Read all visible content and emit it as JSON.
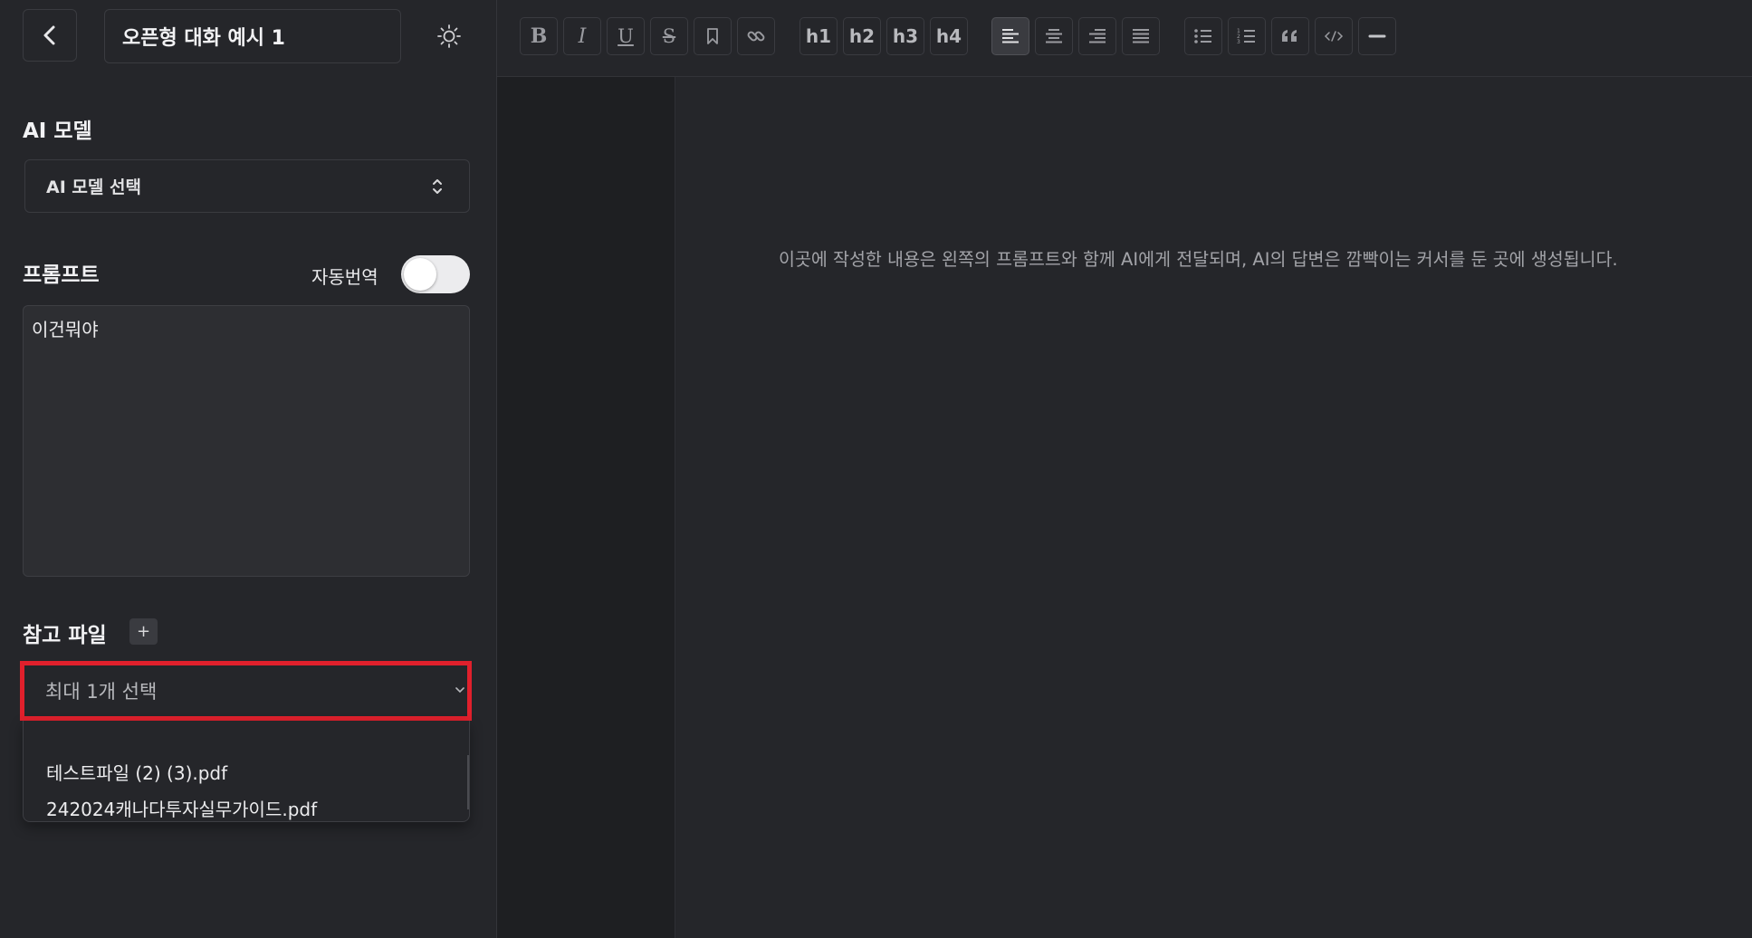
{
  "header": {
    "title": "오픈형 대화 예시 1"
  },
  "model": {
    "section_label": "AI 모델",
    "select_value": "AI 모델 선택"
  },
  "prompt": {
    "section_label": "프롬프트",
    "auto_translate_label": "자동번역",
    "auto_translate_on": false,
    "value": "이건뭐야"
  },
  "files": {
    "section_label": "참고 파일",
    "add_label": "+",
    "select_placeholder": "최대 1개 선택",
    "options": [
      "테스트파일 (2) (3).pdf",
      "242024캐나다투자실무가이드.pdf"
    ]
  },
  "toolbar": {
    "h1": "h1",
    "h2": "h2",
    "h3": "h3",
    "h4": "h4"
  },
  "editor": {
    "placeholder": "이곳에 작성한 내용은 왼쪽의 프롬프트와 함께 AI에게 전달되며, AI의 답변은 깜빡이는 커서를 둔 곳에 생성됩니다."
  },
  "colors": {
    "background": "#25262a",
    "highlight": "#e0202c",
    "gutter": "#1e1f22"
  }
}
